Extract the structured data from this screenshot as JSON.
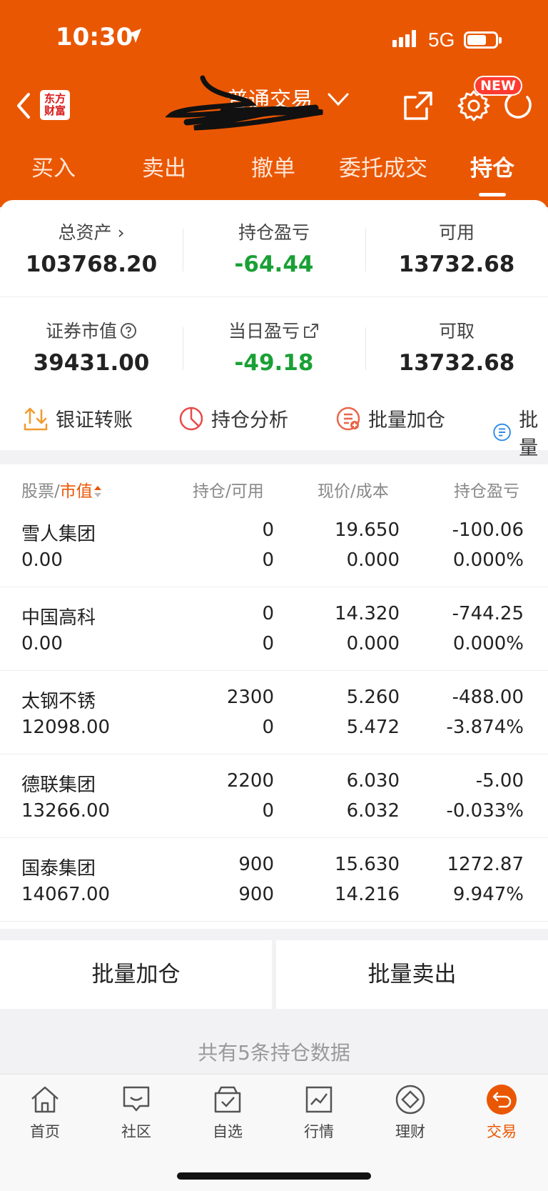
{
  "status_bar": {
    "time": "10:30",
    "network": "5G"
  },
  "header": {
    "logo_line1": "东方",
    "logo_line2": "财富",
    "title": "普通交易",
    "new_badge": "NEW",
    "brand_color": "#ea5703"
  },
  "tabs": [
    {
      "label": "买入",
      "active": false
    },
    {
      "label": "卖出",
      "active": false
    },
    {
      "label": "撤单",
      "active": false
    },
    {
      "label": "委托成交",
      "active": false
    },
    {
      "label": "持仓",
      "active": true
    }
  ],
  "summary": {
    "total_assets": {
      "label": "总资产",
      "value": "103768.20"
    },
    "position_pl": {
      "label": "持仓盈亏",
      "value": "-64.44"
    },
    "available": {
      "label": "可用",
      "value": "13732.68"
    },
    "market_value": {
      "label": "证券市值",
      "value": "39431.00"
    },
    "daily_pl": {
      "label": "当日盈亏",
      "value": "-49.18"
    },
    "withdrawable": {
      "label": "可取",
      "value": "13732.68"
    }
  },
  "quick_actions": [
    {
      "label": "银证转账",
      "icon": "transfer-icon"
    },
    {
      "label": "持仓分析",
      "icon": "pie-chart-icon"
    },
    {
      "label": "批量加仓",
      "icon": "batch-add-icon"
    },
    {
      "label": "批量",
      "icon": "batch-icon"
    }
  ],
  "table": {
    "headers": {
      "stock": "股票",
      "sep": "/",
      "market_value": "市值",
      "position": "持仓/可用",
      "price": "现价/成本",
      "pl": "持仓盈亏"
    },
    "rows": [
      {
        "name": "雪人集团",
        "mv": "0.00",
        "hold": "0",
        "avail": "0",
        "price": "19.650",
        "cost": "0.000",
        "pl": "-100.06",
        "pct": "0.000%",
        "color": "green"
      },
      {
        "name": "中国高科",
        "mv": "0.00",
        "hold": "0",
        "avail": "0",
        "price": "14.320",
        "cost": "0.000",
        "pl": "-744.25",
        "pct": "0.000%",
        "color": "green"
      },
      {
        "name": "太钢不锈",
        "mv": "12098.00",
        "hold": "2300",
        "avail": "0",
        "price": "5.260",
        "cost": "5.472",
        "pl": "-488.00",
        "pct": "-3.874%",
        "color": "green"
      },
      {
        "name": "德联集团",
        "mv": "13266.00",
        "hold": "2200",
        "avail": "0",
        "price": "6.030",
        "cost": "6.032",
        "pl": "-5.00",
        "pct": "-0.033%",
        "color": "green"
      },
      {
        "name": "国泰集团",
        "mv": "14067.00",
        "hold": "900",
        "avail": "900",
        "price": "15.630",
        "cost": "14.216",
        "pl": "1272.87",
        "pct": "9.947%",
        "color": "red"
      }
    ]
  },
  "buttons": {
    "batch_add": "批量加仓",
    "batch_sell": "批量卖出"
  },
  "footer_note": "共有5条持仓数据",
  "tabbar": [
    {
      "label": "首页",
      "icon": "home-icon"
    },
    {
      "label": "社区",
      "icon": "community-icon"
    },
    {
      "label": "自选",
      "icon": "watchlist-icon"
    },
    {
      "label": "行情",
      "icon": "market-icon"
    },
    {
      "label": "理财",
      "icon": "wealth-icon"
    },
    {
      "label": "交易",
      "icon": "trade-icon",
      "active": true
    }
  ],
  "colors": {
    "gain": "#e63030",
    "loss": "#1aa035",
    "accent": "#ea5703"
  }
}
